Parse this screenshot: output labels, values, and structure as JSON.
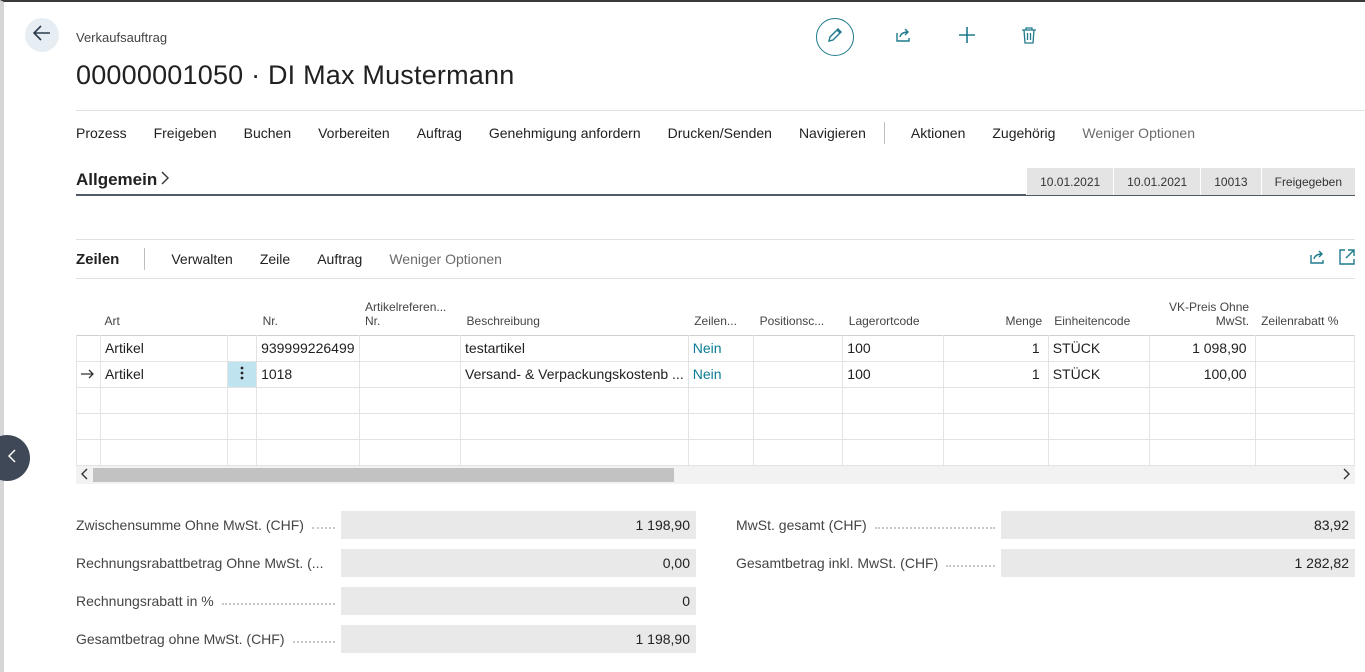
{
  "header": {
    "caption": "Verkaufsauftrag",
    "title": "00000001050 · DI Max Mustermann"
  },
  "actionbar": {
    "items": [
      "Prozess",
      "Freigeben",
      "Buchen",
      "Vorbereiten",
      "Auftrag",
      "Genehmigung anfordern",
      "Drucken/Senden",
      "Navigieren"
    ],
    "items_right": [
      "Aktionen",
      "Zugehörig"
    ],
    "fewer_options": "Weniger Optionen"
  },
  "general": {
    "title": "Allgemein",
    "pills": [
      "10.01.2021",
      "10.01.2021",
      "10013",
      "Freigegeben"
    ]
  },
  "lines": {
    "title": "Zeilen",
    "actions": [
      "Verwalten",
      "Zeile",
      "Auftrag"
    ],
    "fewer_options": "Weniger Optionen",
    "columns": [
      "Art",
      "Nr.",
      "Artikelreferen... Nr.",
      "Beschreibung",
      "Zeilen...",
      "Positionsc...",
      "Lagerortcode",
      "Menge",
      "Einheitencode",
      "VK-Preis Ohne MwSt.",
      "Zeilenrabatt %"
    ],
    "rows": [
      {
        "art": "Artikel",
        "nr": "939999226499",
        "ref": "",
        "beschreibung": "testartikel",
        "zeilen": "Nein",
        "position": "",
        "lager": "100",
        "menge": "1",
        "einheit": "STÜCK",
        "preis": "1 098,90",
        "rabatt": ""
      },
      {
        "art": "Artikel",
        "nr": "1018",
        "ref": "",
        "beschreibung": "Versand- & Verpackungskostenb ...",
        "zeilen": "Nein",
        "position": "",
        "lager": "100",
        "menge": "1",
        "einheit": "STÜCK",
        "preis": "100,00",
        "rabatt": ""
      }
    ]
  },
  "totals": {
    "subtotal_label": "Zwischensumme Ohne MwSt. (CHF)",
    "subtotal_value": "1 198,90",
    "invoice_discount_amount_label": "Rechnungsrabattbetrag Ohne MwSt. (...",
    "invoice_discount_amount_value": "0,00",
    "invoice_discount_pct_label": "Rechnungsrabatt in %",
    "invoice_discount_pct_value": "0",
    "total_excl_label": "Gesamtbetrag ohne MwSt. (CHF)",
    "total_excl_value": "1 198,90",
    "vat_label": "MwSt. gesamt (CHF)",
    "vat_value": "83,92",
    "total_incl_label": "Gesamtbetrag inkl. MwSt. (CHF)",
    "total_incl_value": "1 282,82"
  },
  "icons": {
    "back": "arrow-left-icon",
    "edit": "pencil-icon",
    "share": "share-icon",
    "new": "plus-icon",
    "delete": "trash-icon",
    "expand": "expand-icon",
    "row_selected": "arrow-right-icon",
    "row_menu": "vertical-ellipsis-icon",
    "side_toggle": "chevron-left-icon"
  },
  "colors": {
    "accent": "#1f7a8c",
    "link": "#0b7a94",
    "selected_cell": "#bfe3ef"
  }
}
